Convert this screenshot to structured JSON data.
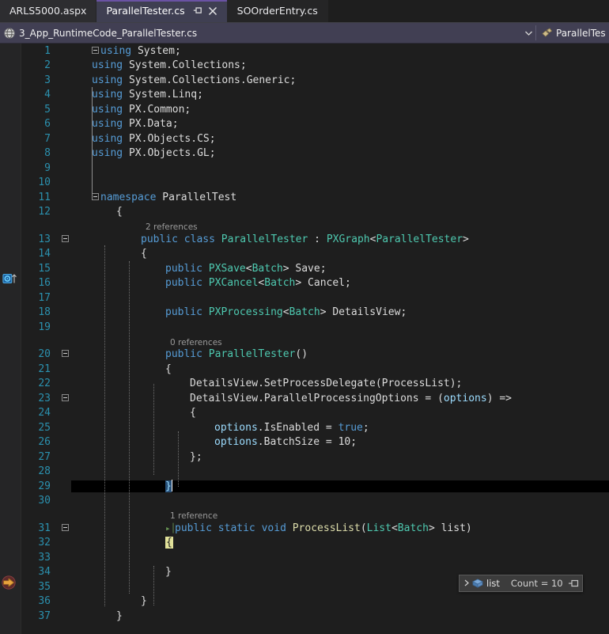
{
  "window": {
    "theme_name": "Visual Studio Dark",
    "colors": {
      "editor_background": "#1e1e1e",
      "tab_active_background": "#3f3f52",
      "tab_active_accent": "#6a52a3",
      "navbar_background": "#413f53",
      "keyword": "#569cd6",
      "type": "#4ec9b0",
      "method": "#dcdcaa",
      "parameter": "#9cdcfe",
      "line_number": "#2b91af",
      "codelens": "#9a9a9a",
      "current_line_highlight": "#000000",
      "brace_match": "#e2e29a",
      "execution_pointer": "#e8a33d"
    }
  },
  "tabs": [
    {
      "label": "ARLS5000.aspx",
      "active": false,
      "pinned": false,
      "closable": false
    },
    {
      "label": "ParallelTester.cs",
      "active": true,
      "pinned": true,
      "closable": true
    },
    {
      "label": "SOOrderEntry.cs",
      "active": false,
      "pinned": false,
      "closable": false
    }
  ],
  "navbar": {
    "document_icon": "document-globe-icon",
    "filename": "3_App_RuntimeCode_ParallelTester.cs",
    "dropdown_caret": "chevron-down-icon",
    "namespace_icon": "namespace-icon",
    "namespace_label": "ParallelTest."
  },
  "editor": {
    "first_line": 1,
    "last_line": 37,
    "current_line": 29,
    "gutter_icons": [
      {
        "line": 13,
        "name": "inheritance-up-icon",
        "tooltip": ""
      },
      {
        "line": 32,
        "name": "execution-pointer-icon",
        "tooltip": ""
      }
    ],
    "codelens": [
      {
        "above_line": 13,
        "text": "2 references"
      },
      {
        "above_line": 20,
        "text": "0 references"
      },
      {
        "above_line": 31,
        "text": "1 reference"
      }
    ],
    "lines": [
      {
        "n": 1,
        "indent": 0,
        "collapse": "minus",
        "tokens": [
          {
            "t": "using",
            "c": "kw"
          },
          {
            "t": " ",
            "c": "id"
          },
          {
            "t": "System",
            "c": "id"
          },
          {
            "t": ";",
            "c": "punc"
          }
        ]
      },
      {
        "n": 2,
        "indent": 0,
        "tokens": [
          {
            "t": "using",
            "c": "kw"
          },
          {
            "t": " ",
            "c": "id"
          },
          {
            "t": "System",
            "c": "id"
          },
          {
            "t": ".",
            "c": "punc"
          },
          {
            "t": "Collections",
            "c": "id"
          },
          {
            "t": ";",
            "c": "punc"
          }
        ]
      },
      {
        "n": 3,
        "indent": 0,
        "tokens": [
          {
            "t": "using",
            "c": "kw"
          },
          {
            "t": " ",
            "c": "id"
          },
          {
            "t": "System",
            "c": "id"
          },
          {
            "t": ".",
            "c": "punc"
          },
          {
            "t": "Collections",
            "c": "id"
          },
          {
            "t": ".",
            "c": "punc"
          },
          {
            "t": "Generic",
            "c": "id"
          },
          {
            "t": ";",
            "c": "punc"
          }
        ]
      },
      {
        "n": 4,
        "indent": 0,
        "tokens": [
          {
            "t": "using",
            "c": "kw"
          },
          {
            "t": " ",
            "c": "id"
          },
          {
            "t": "System",
            "c": "id"
          },
          {
            "t": ".",
            "c": "punc"
          },
          {
            "t": "Linq",
            "c": "id"
          },
          {
            "t": ";",
            "c": "punc"
          }
        ]
      },
      {
        "n": 5,
        "indent": 0,
        "tokens": [
          {
            "t": "using",
            "c": "kw"
          },
          {
            "t": " ",
            "c": "id"
          },
          {
            "t": "PX",
            "c": "id"
          },
          {
            "t": ".",
            "c": "punc"
          },
          {
            "t": "Common",
            "c": "id"
          },
          {
            "t": ";",
            "c": "punc"
          }
        ]
      },
      {
        "n": 6,
        "indent": 0,
        "tokens": [
          {
            "t": "using",
            "c": "kw"
          },
          {
            "t": " ",
            "c": "id"
          },
          {
            "t": "PX",
            "c": "id"
          },
          {
            "t": ".",
            "c": "punc"
          },
          {
            "t": "Data",
            "c": "id"
          },
          {
            "t": ";",
            "c": "punc"
          }
        ]
      },
      {
        "n": 7,
        "indent": 0,
        "tokens": [
          {
            "t": "using",
            "c": "kw"
          },
          {
            "t": " ",
            "c": "id"
          },
          {
            "t": "PX",
            "c": "id"
          },
          {
            "t": ".",
            "c": "punc"
          },
          {
            "t": "Objects",
            "c": "id"
          },
          {
            "t": ".",
            "c": "punc"
          },
          {
            "t": "CS",
            "c": "id"
          },
          {
            "t": ";",
            "c": "punc"
          }
        ]
      },
      {
        "n": 8,
        "indent": 0,
        "tokens": [
          {
            "t": "using",
            "c": "kw"
          },
          {
            "t": " ",
            "c": "id"
          },
          {
            "t": "PX",
            "c": "id"
          },
          {
            "t": ".",
            "c": "punc"
          },
          {
            "t": "Objects",
            "c": "id"
          },
          {
            "t": ".",
            "c": "punc"
          },
          {
            "t": "GL",
            "c": "id"
          },
          {
            "t": ";",
            "c": "punc"
          }
        ]
      },
      {
        "n": 9,
        "indent": 0,
        "tokens": []
      },
      {
        "n": 10,
        "indent": 0,
        "tokens": []
      },
      {
        "n": 11,
        "indent": 0,
        "collapse": "minus",
        "tokens": [
          {
            "t": "namespace",
            "c": "kw"
          },
          {
            "t": " ",
            "c": "id"
          },
          {
            "t": "ParallelTest",
            "c": "id"
          }
        ]
      },
      {
        "n": 12,
        "indent": 1,
        "tokens": [
          {
            "t": "{",
            "c": "punc"
          }
        ]
      },
      {
        "n": 13,
        "indent": 2,
        "collapse": "minus",
        "tokens": [
          {
            "t": "public",
            "c": "kw"
          },
          {
            "t": " ",
            "c": "id"
          },
          {
            "t": "class",
            "c": "kw"
          },
          {
            "t": " ",
            "c": "id"
          },
          {
            "t": "ParallelTester",
            "c": "typ"
          },
          {
            "t": " : ",
            "c": "punc"
          },
          {
            "t": "PXGraph",
            "c": "typ"
          },
          {
            "t": "<",
            "c": "punc"
          },
          {
            "t": "ParallelTester",
            "c": "typ"
          },
          {
            "t": ">",
            "c": "punc"
          }
        ]
      },
      {
        "n": 14,
        "indent": 2,
        "tokens": [
          {
            "t": "{",
            "c": "punc"
          }
        ]
      },
      {
        "n": 15,
        "indent": 3,
        "tokens": [
          {
            "t": "public",
            "c": "kw"
          },
          {
            "t": " ",
            "c": "id"
          },
          {
            "t": "PXSave",
            "c": "typ"
          },
          {
            "t": "<",
            "c": "punc"
          },
          {
            "t": "Batch",
            "c": "typ"
          },
          {
            "t": "> ",
            "c": "punc"
          },
          {
            "t": "Save",
            "c": "id"
          },
          {
            "t": ";",
            "c": "punc"
          }
        ]
      },
      {
        "n": 16,
        "indent": 3,
        "tokens": [
          {
            "t": "public",
            "c": "kw"
          },
          {
            "t": " ",
            "c": "id"
          },
          {
            "t": "PXCancel",
            "c": "typ"
          },
          {
            "t": "<",
            "c": "punc"
          },
          {
            "t": "Batch",
            "c": "typ"
          },
          {
            "t": "> ",
            "c": "punc"
          },
          {
            "t": "Cancel",
            "c": "id"
          },
          {
            "t": ";",
            "c": "punc"
          }
        ]
      },
      {
        "n": 17,
        "indent": 3,
        "tokens": []
      },
      {
        "n": 18,
        "indent": 3,
        "tokens": [
          {
            "t": "public",
            "c": "kw"
          },
          {
            "t": " ",
            "c": "id"
          },
          {
            "t": "PXProcessing",
            "c": "typ"
          },
          {
            "t": "<",
            "c": "punc"
          },
          {
            "t": "Batch",
            "c": "typ"
          },
          {
            "t": "> ",
            "c": "punc"
          },
          {
            "t": "DetailsView",
            "c": "id"
          },
          {
            "t": ";",
            "c": "punc"
          }
        ]
      },
      {
        "n": 19,
        "indent": 3,
        "tokens": []
      },
      {
        "n": 20,
        "indent": 3,
        "collapse": "minus",
        "tokens": [
          {
            "t": "public",
            "c": "kw"
          },
          {
            "t": " ",
            "c": "id"
          },
          {
            "t": "ParallelTester",
            "c": "typ"
          },
          {
            "t": "()",
            "c": "punc"
          }
        ]
      },
      {
        "n": 21,
        "indent": 3,
        "tokens": [
          {
            "t": "{",
            "c": "punc"
          }
        ]
      },
      {
        "n": 22,
        "indent": 4,
        "tokens": [
          {
            "t": "DetailsView",
            "c": "id"
          },
          {
            "t": ".",
            "c": "punc"
          },
          {
            "t": "SetProcessDelegate",
            "c": "id"
          },
          {
            "t": "(",
            "c": "punc"
          },
          {
            "t": "ProcessList",
            "c": "id"
          },
          {
            "t": ");",
            "c": "punc"
          }
        ]
      },
      {
        "n": 23,
        "indent": 4,
        "collapse": "minus",
        "tokens": [
          {
            "t": "DetailsView",
            "c": "id"
          },
          {
            "t": ".",
            "c": "punc"
          },
          {
            "t": "ParallelProcessingOptions",
            "c": "id"
          },
          {
            "t": " = (",
            "c": "punc"
          },
          {
            "t": "options",
            "c": "prm"
          },
          {
            "t": ") =>",
            "c": "punc"
          }
        ]
      },
      {
        "n": 24,
        "indent": 4,
        "tokens": [
          {
            "t": "{",
            "c": "punc"
          }
        ]
      },
      {
        "n": 25,
        "indent": 5,
        "tokens": [
          {
            "t": "options",
            "c": "prm"
          },
          {
            "t": ".",
            "c": "punc"
          },
          {
            "t": "IsEnabled",
            "c": "id"
          },
          {
            "t": " = ",
            "c": "punc"
          },
          {
            "t": "true",
            "c": "kw"
          },
          {
            "t": ";",
            "c": "punc"
          }
        ]
      },
      {
        "n": 26,
        "indent": 5,
        "tokens": [
          {
            "t": "options",
            "c": "prm"
          },
          {
            "t": ".",
            "c": "punc"
          },
          {
            "t": "BatchSize",
            "c": "id"
          },
          {
            "t": " = ",
            "c": "punc"
          },
          {
            "t": "10",
            "c": "id"
          },
          {
            "t": ";",
            "c": "punc"
          }
        ]
      },
      {
        "n": 27,
        "indent": 4,
        "tokens": [
          {
            "t": "};",
            "c": "punc"
          }
        ]
      },
      {
        "n": 28,
        "indent": 4,
        "tokens": []
      },
      {
        "n": 29,
        "indent": 3,
        "highlighted": true,
        "caret": true,
        "tokens": [
          {
            "t": "}",
            "c": "sel"
          }
        ]
      },
      {
        "n": 30,
        "indent": 3,
        "tokens": []
      },
      {
        "n": 31,
        "indent": 3,
        "collapse": "minus",
        "runarrow": true,
        "tokens": [
          {
            "t": "public",
            "c": "kw"
          },
          {
            "t": " ",
            "c": "id"
          },
          {
            "t": "static",
            "c": "kw"
          },
          {
            "t": " ",
            "c": "id"
          },
          {
            "t": "void",
            "c": "kw"
          },
          {
            "t": " ",
            "c": "id"
          },
          {
            "t": "ProcessList",
            "c": "mth"
          },
          {
            "t": "(",
            "c": "punc"
          },
          {
            "t": "List",
            "c": "typ"
          },
          {
            "t": "<",
            "c": "punc"
          },
          {
            "t": "Batch",
            "c": "typ"
          },
          {
            "t": "> ",
            "c": "punc"
          },
          {
            "t": "list",
            "c": "id"
          },
          {
            "t": ")",
            "c": "punc"
          }
        ]
      },
      {
        "n": 32,
        "indent": 3,
        "tokens": [
          {
            "t": "{",
            "c": "brace-hl"
          }
        ]
      },
      {
        "n": 33,
        "indent": 4,
        "tokens": []
      },
      {
        "n": 34,
        "indent": 3,
        "tokens": [
          {
            "t": "}",
            "c": "punc"
          }
        ]
      },
      {
        "n": 35,
        "indent": 2,
        "tokens": []
      },
      {
        "n": 36,
        "indent": 2,
        "tokens": [
          {
            "t": "}",
            "c": "punc"
          }
        ]
      },
      {
        "n": 37,
        "indent": 1,
        "tokens": [
          {
            "t": "}",
            "c": "punc"
          }
        ]
      }
    ]
  },
  "datatip": {
    "expander_icon": "chevron-right-icon",
    "value_icon": "object-box-icon",
    "name": "list",
    "value": "Count = 10",
    "pin_icon": "pin-icon"
  }
}
